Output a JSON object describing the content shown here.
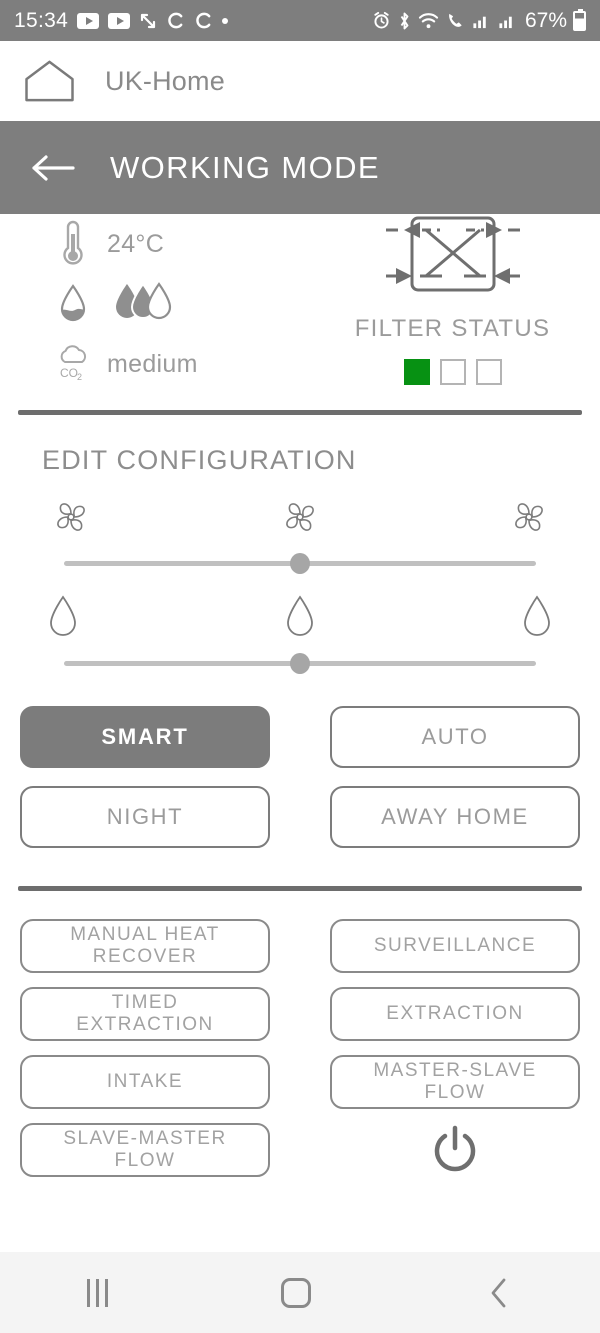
{
  "status_bar": {
    "time": "15:34",
    "battery_percent": "67%",
    "left_icons": [
      "youtube-icon",
      "youtube-icon",
      "screenshot-icon",
      "c-icon",
      "c-icon",
      "dot-icon"
    ],
    "right_icons": [
      "alarm-icon",
      "bluetooth-icon",
      "wifi-icon",
      "call-icon",
      "signal-icon",
      "signal-icon",
      "battery-icon"
    ]
  },
  "app_bar": {
    "home_icon": "home-icon",
    "title": "UK-Home"
  },
  "mode_bar": {
    "back_icon": "back-arrow-icon",
    "title": "WORKING MODE"
  },
  "status_panel": {
    "temperature": {
      "icon": "thermometer-icon",
      "value": "24°C"
    },
    "humidity": {
      "icon": "water-drop-icon",
      "level_icon": "humidity-level-icon",
      "filled_drops": 2,
      "total_drops": 3
    },
    "co2": {
      "icon": "co2-cloud-icon",
      "value": "medium"
    },
    "filter": {
      "exchanger_icon": "heat-exchanger-icon",
      "label": "FILTER STATUS",
      "squares": [
        true,
        false,
        false
      ],
      "active_color": "#079113"
    }
  },
  "edit_configuration": {
    "title": "EDIT CONFIGURATION",
    "fan_slider": {
      "icons": [
        "fan-small-icon",
        "fan-medium-icon",
        "fan-large-icon"
      ],
      "value_percent": 50
    },
    "humidity_slider": {
      "icons": [
        "drop-small-icon",
        "drop-medium-icon",
        "drop-large-icon"
      ],
      "value_percent": 50
    }
  },
  "mode_buttons": [
    {
      "label": "SMART",
      "active": true
    },
    {
      "label": "AUTO",
      "active": false
    },
    {
      "label": "NIGHT",
      "active": false
    },
    {
      "label": "AWAY HOME",
      "active": false
    }
  ],
  "special_buttons": [
    {
      "label": "MANUAL HEAT\nRECOVER"
    },
    {
      "label": "SURVEILLANCE"
    },
    {
      "label": "TIMED\nEXTRACTION"
    },
    {
      "label": "EXTRACTION"
    },
    {
      "label": "INTAKE"
    },
    {
      "label": "MASTER-SLAVE\nFLOW"
    },
    {
      "label": "SLAVE-MASTER\nFLOW"
    }
  ],
  "power_button": {
    "icon": "power-icon"
  },
  "nav_bar": {
    "recents_icon": "recents-icon",
    "home_icon": "home-square-icon",
    "back_icon": "back-chevron-icon"
  },
  "colors": {
    "bar_gray": "#7e7e7e",
    "text_gray": "#9b9b9b",
    "border_gray": "#7c7c7c",
    "filter_green": "#079113"
  }
}
